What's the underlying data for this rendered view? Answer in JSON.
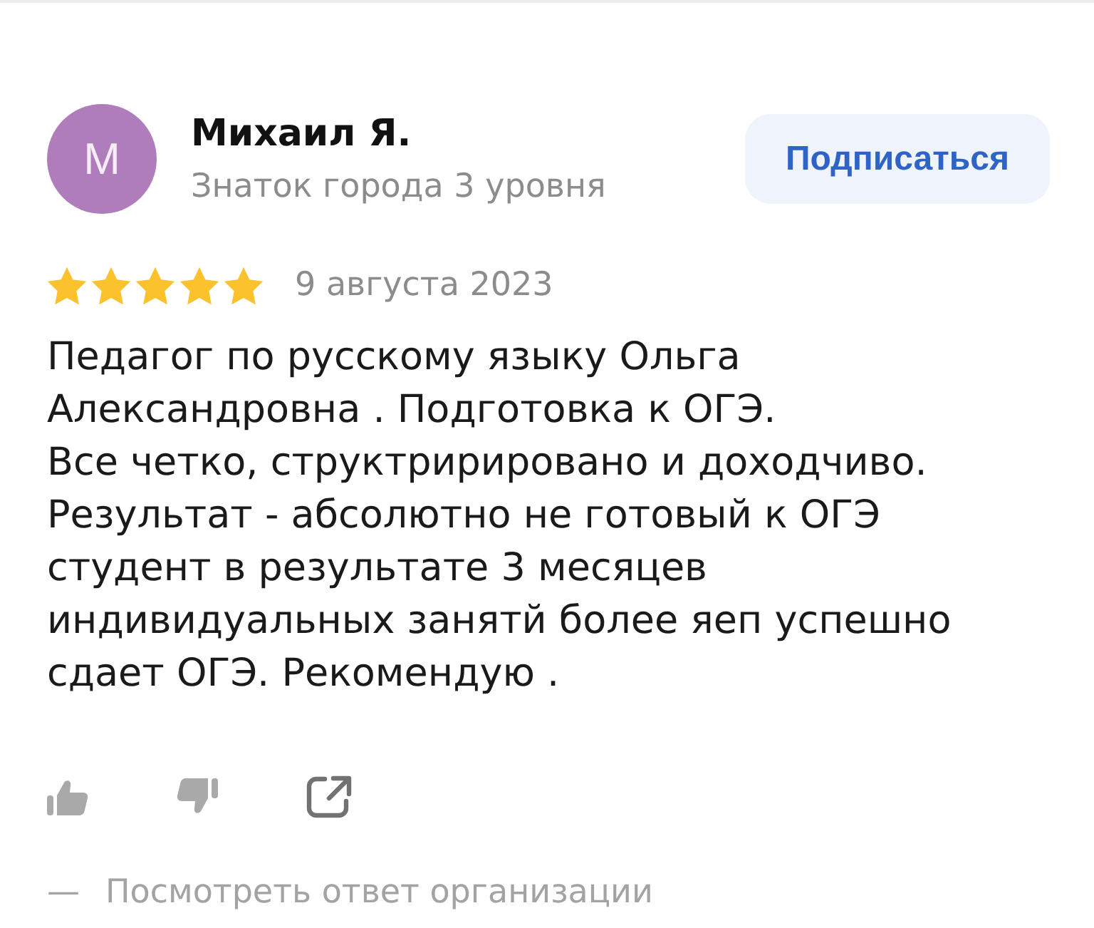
{
  "review": {
    "author": {
      "avatar_letter": "М",
      "name": "Михаил Я.",
      "status": "Знаток города 3 уровня"
    },
    "subscribe_button": "Подписаться",
    "stars": 5,
    "date": "9 августа 2023",
    "text": "Педагог по русскому языку Ольга\nАлександровна . Подготовка к ОГЭ.\nВсе четко, структририровано и доходчиво.\nРезультат - абсолютно не готовый к ОГЭ\nстудент в результате 3 месяцев\nиндивидуальных занятй более яеп успешно\nсдает ОГЭ. Рекомендую .",
    "actions": [
      {
        "kind": "like"
      },
      {
        "kind": "dislike"
      },
      {
        "kind": "share"
      }
    ],
    "org_reply": {
      "marker": "—",
      "label": "Посмотреть ответ организации"
    }
  }
}
